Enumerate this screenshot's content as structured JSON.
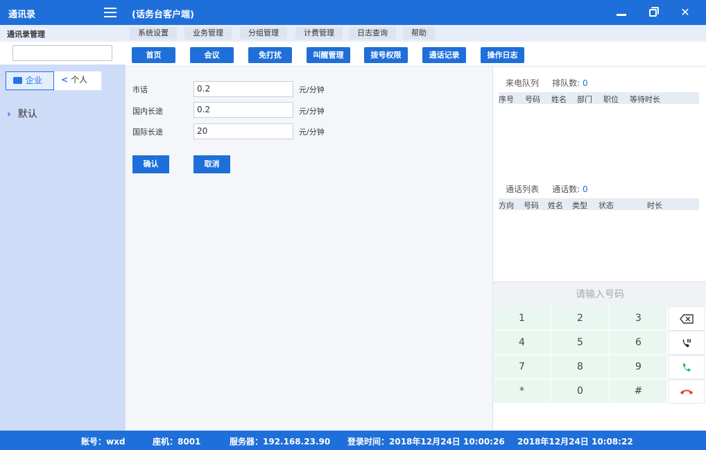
{
  "window": {
    "app_title": "通讯录",
    "client_title": "(话务台客户端)",
    "close_glyph": "✕"
  },
  "sidebar": {
    "header": "通讯录管理",
    "search_value": "",
    "tabs": [
      {
        "label": "企业",
        "active": true
      },
      {
        "label": "个人",
        "active": false
      }
    ],
    "tree": [
      {
        "label": "默认",
        "chevron": "›"
      }
    ]
  },
  "menu": [
    "系统设置",
    "业务管理",
    "分组管理",
    "计费管理",
    "日志查询",
    "帮助"
  ],
  "toolbar": [
    "首页",
    "会议",
    "免打扰",
    "叫醒管理",
    "拨号权限",
    "通话记录",
    "操作日志"
  ],
  "billing": {
    "rows": [
      {
        "label": "市话",
        "value": "0.2",
        "unit": "元/分钟"
      },
      {
        "label": "国内长途",
        "value": "0.2",
        "unit": "元/分钟"
      },
      {
        "label": "国际长途",
        "value": "20",
        "unit": "元/分钟"
      }
    ],
    "confirm_label": "确认",
    "cancel_label": "取消"
  },
  "queue": {
    "title": "来电队列",
    "count_label": "排队数:",
    "count": "0",
    "columns": [
      "序号",
      "号码",
      "姓名",
      "部门",
      "职位",
      "等待时长"
    ]
  },
  "calls": {
    "title": "通话列表",
    "count_label": "通话数:",
    "count": "0",
    "columns": [
      "方向",
      "号码",
      "姓名",
      "类型",
      "状态",
      "时长"
    ]
  },
  "dialer": {
    "placeholder": "请输入号码",
    "keys": [
      "1",
      "2",
      "3",
      "4",
      "5",
      "6",
      "7",
      "8",
      "9",
      "*",
      "0",
      "#"
    ],
    "side_icons": [
      "backspace-icon",
      "phone-transfer-icon",
      "phone-call-icon",
      "phone-hangup-icon"
    ],
    "accent_green": "#2bbf6a",
    "accent_red": "#e0453a"
  },
  "status": {
    "account": "账号：wxd",
    "extension": "座机：8001",
    "server": "服务器：192.168.23.90",
    "login_time": "登录时间：2018年12月24日 10:00:26",
    "current_time": "2018年12月24日 10:08:22"
  },
  "colors": {
    "primary": "#1e6fd9",
    "sidebar_bg": "#cfdcf7"
  }
}
